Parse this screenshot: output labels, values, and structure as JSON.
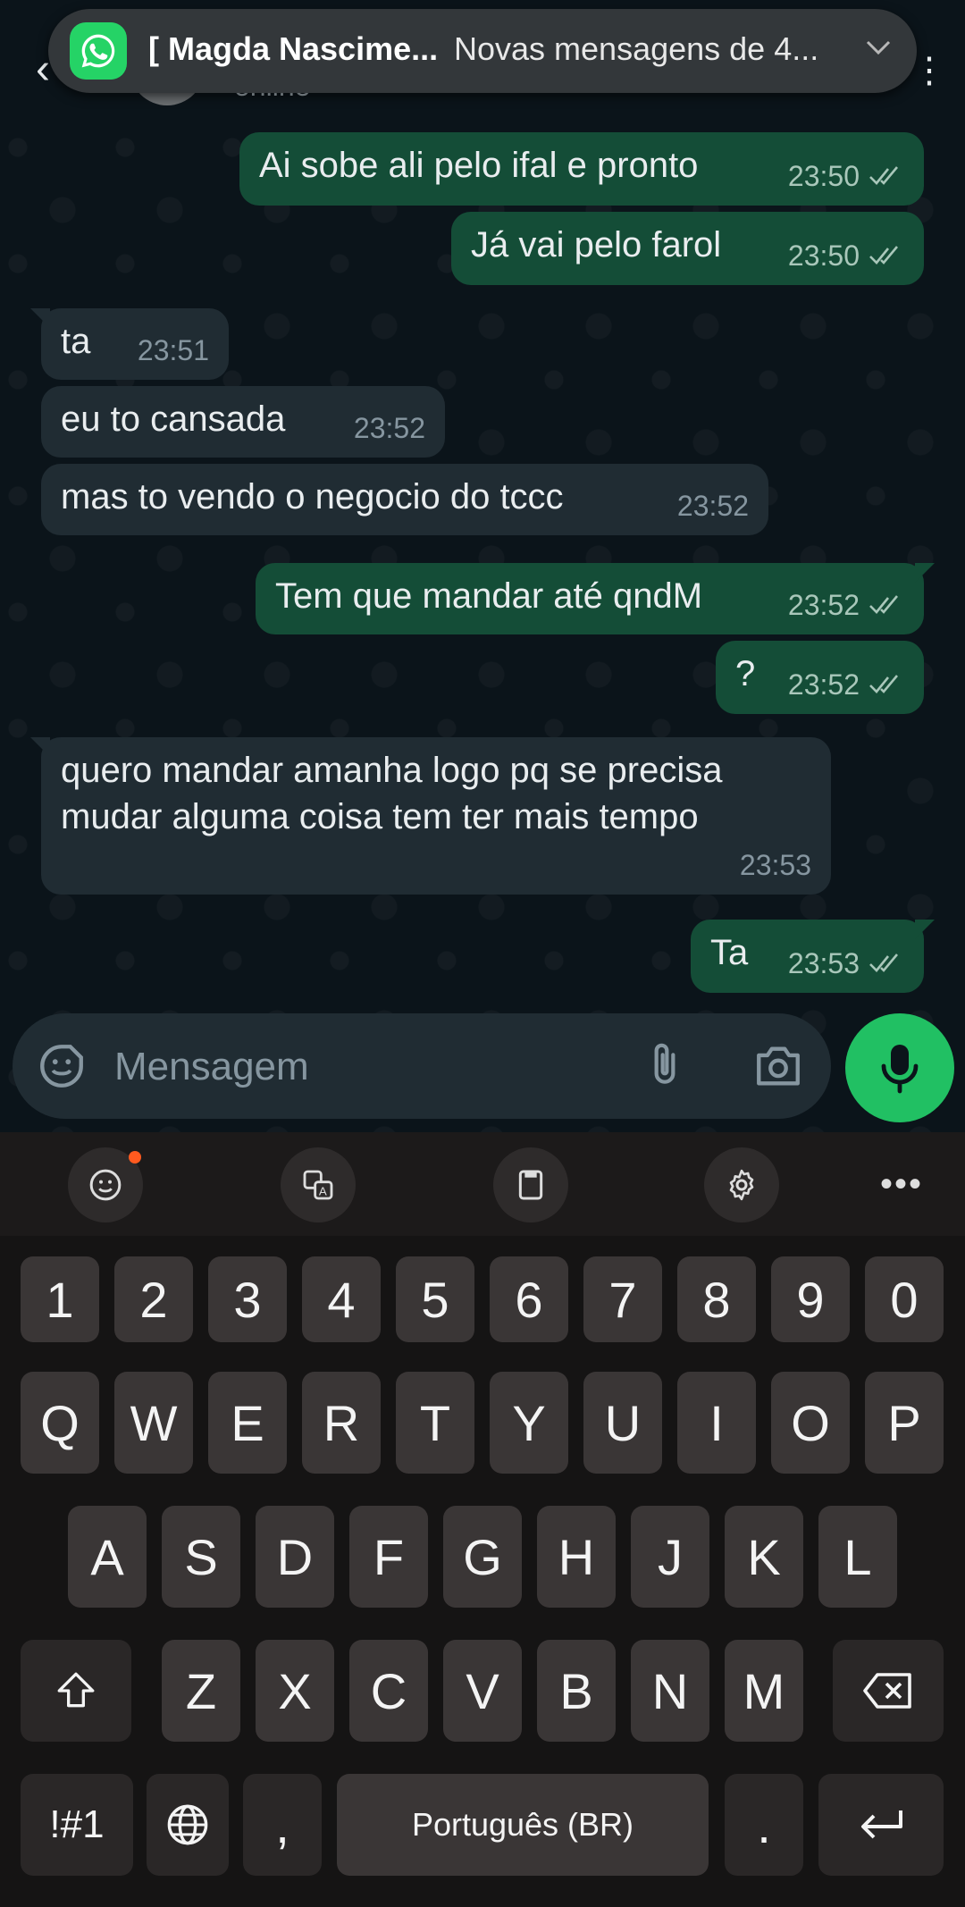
{
  "header": {
    "status": "online"
  },
  "notification": {
    "title": "[ Magda Nascime...",
    "text": "Novas mensagens de 4..."
  },
  "messages": [
    {
      "dir": "out",
      "text": "Ai sobe ali pelo ifal e pronto",
      "time": "23:50",
      "ticks": "read"
    },
    {
      "dir": "out",
      "text": "Já vai pelo farol",
      "time": "23:50",
      "ticks": "read"
    },
    {
      "dir": "in",
      "text": "ta",
      "time": "23:51"
    },
    {
      "dir": "in",
      "text": "eu to cansada",
      "time": "23:52"
    },
    {
      "dir": "in",
      "text": "mas to vendo o negocio do tccc",
      "time": "23:52"
    },
    {
      "dir": "out",
      "text": "Tem que mandar até qndM",
      "time": "23:52",
      "ticks": "read"
    },
    {
      "dir": "out",
      "text": "?",
      "time": "23:52",
      "ticks": "read"
    },
    {
      "dir": "in",
      "text_line1": "quero mandar amanha logo pq se precisa",
      "text_line2": "mudar alguma coisa tem ter mais tempo",
      "time": "23:53"
    },
    {
      "dir": "out",
      "text": "Ta",
      "time": "23:53",
      "ticks": "read"
    }
  ],
  "composer": {
    "placeholder": "Mensagem"
  },
  "colors": {
    "outgoing_bubble": "#144d37",
    "incoming_bubble": "#202c33",
    "mic_button": "#21c063",
    "tick_color": "#a9c7ba"
  },
  "keyboard": {
    "row_numbers": [
      "1",
      "2",
      "3",
      "4",
      "5",
      "6",
      "7",
      "8",
      "9",
      "0"
    ],
    "row1": [
      "Q",
      "W",
      "E",
      "R",
      "T",
      "Y",
      "U",
      "I",
      "O",
      "P"
    ],
    "row2": [
      "A",
      "S",
      "D",
      "F",
      "G",
      "H",
      "J",
      "K",
      "L"
    ],
    "row3": [
      "Z",
      "X",
      "C",
      "V",
      "B",
      "N",
      "M"
    ],
    "symbols_key": "!#1",
    "comma_key": ",",
    "space_label": "Português (BR)",
    "period_key": "."
  },
  "icons": {
    "back": "arrow-left-icon",
    "notification_app": "whatsapp-icon",
    "expand": "chevron-down-icon",
    "emoji": "sticker-emoji-icon",
    "attach": "paperclip-icon",
    "camera": "camera-icon",
    "mic": "microphone-icon",
    "read_ticks": "double-check-icon"
  }
}
